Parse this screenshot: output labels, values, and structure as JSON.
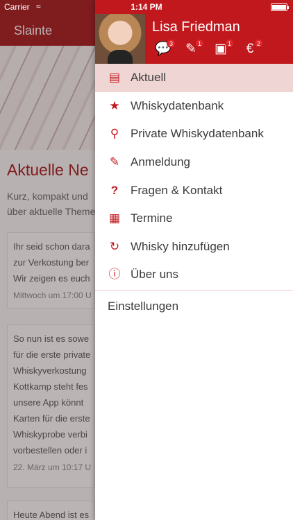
{
  "status_bar": {
    "carrier": "Carrier",
    "time": "1:14 PM"
  },
  "background": {
    "nav_title": "Slainte",
    "heading": "Aktuelle Ne",
    "subtitle_lines": [
      "Kurz, kompakt und",
      "über aktuelle Theme"
    ],
    "cards": [
      {
        "lines": [
          "Ihr seid schon dara",
          "zur Verkostung ber",
          "Wir zeigen es euch"
        ],
        "date": "Mittwoch um 17:00 U"
      },
      {
        "lines": [
          "So nun ist es sowe",
          "für die erste private",
          "Whiskyverkostung",
          "Kottkamp steht fes",
          "unsere App könnt",
          "Karten für die erste",
          "Whiskyprobe verbi",
          "vorbestellen oder i"
        ],
        "date": "22. März um 10:17 U"
      },
      {
        "lines": [
          "Heute Abend ist es"
        ],
        "date": ""
      }
    ]
  },
  "drawer": {
    "user_name": "Lisa Friedman",
    "header_icons": [
      {
        "icon": "chat-icon",
        "badge": "3"
      },
      {
        "icon": "tasting-icon",
        "badge": "1"
      },
      {
        "icon": "documents-icon",
        "badge": "1"
      },
      {
        "icon": "euro-icon",
        "badge": "2"
      }
    ],
    "menu": [
      {
        "label": "Aktuell",
        "icon": "newspaper-icon",
        "active": true
      },
      {
        "label": "Whiskydatenbank",
        "icon": "star-icon"
      },
      {
        "label": "Private Whiskydatenbank",
        "icon": "key-icon"
      },
      {
        "label": "Anmeldung",
        "icon": "edit-icon"
      },
      {
        "label": "Fragen & Kontakt",
        "icon": "question-icon"
      },
      {
        "label": "Termine",
        "icon": "calendar-icon"
      },
      {
        "label": "Whisky hinzufügen",
        "icon": "refresh-icon"
      },
      {
        "label": "Über uns",
        "icon": "info-icon"
      }
    ],
    "settings_label": "Einstellungen"
  },
  "colors": {
    "brand": "#c0181d",
    "active_bg": "#f0d5d5"
  }
}
